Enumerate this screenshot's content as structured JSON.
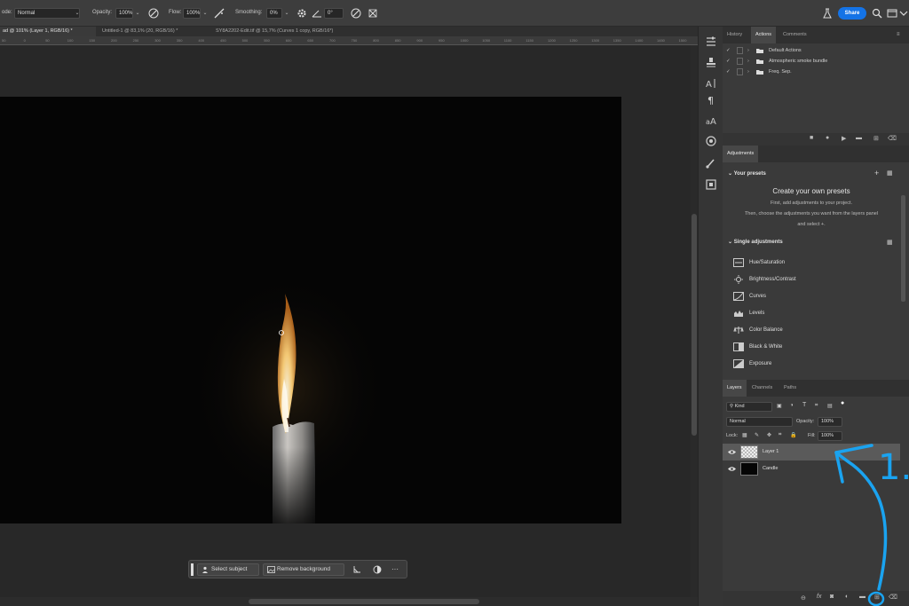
{
  "options_bar": {
    "mode_label": "ode:",
    "mode_value": "Normal",
    "opacity_label": "Opacity:",
    "opacity_value": "100%",
    "flow_label": "Flow:",
    "flow_value": "100%",
    "smoothing_label": "Smoothing:",
    "smoothing_value": "0%",
    "angle_value": "0°",
    "share_label": "Share"
  },
  "tabs": [
    {
      "label": "ad @ 101% (Layer 1, RGB/16) *",
      "active": true
    },
    {
      "label": "Untitled-1 @ 83,1% (20, RGB/16) *",
      "active": false
    },
    {
      "label": "SY8A2202-Edit.tif @ 15,7% (Curves 1 copy, RGB/16*)",
      "active": false
    }
  ],
  "ruler_ticks": [
    "50",
    "0",
    "50",
    "100",
    "150",
    "200",
    "250",
    "300",
    "350",
    "400",
    "450",
    "500",
    "550",
    "600",
    "650",
    "700",
    "750",
    "800",
    "850",
    "900",
    "950",
    "1000",
    "1050",
    "1100",
    "1150",
    "1200",
    "1250",
    "1300",
    "1350",
    "1400",
    "1450",
    "1500"
  ],
  "taskbar": {
    "select_subject": "Select subject",
    "remove_background": "Remove background",
    "more": "···"
  },
  "history_panel": {
    "tabs": [
      "History",
      "Actions",
      "Comments"
    ],
    "active_tab": "Actions",
    "actions": [
      "Default Actions",
      "Atmospheric smoke bundle",
      "Freq. Sep."
    ]
  },
  "adjustments_panel": {
    "title": "Adjustments",
    "your_presets": "Your presets",
    "create_title": "Create your own presets",
    "create_line1": "First, add adjustments to your project.",
    "create_line2": "Then, choose the adjustments you want from the layers panel",
    "create_line3": "and select",
    "single_adjustments": "Single adjustments",
    "items": [
      "Hue/Saturation",
      "Brightness/Contrast",
      "Curves",
      "Levels",
      "Color Balance",
      "Black & White",
      "Exposure"
    ]
  },
  "layers_panel": {
    "tabs": [
      "Layers",
      "Channels",
      "Paths"
    ],
    "active_tab": "Layers",
    "kind_label": "Kind",
    "blend_mode": "Normal",
    "opacity_label": "Opacity:",
    "opacity_value": "100%",
    "lock_label": "Lock:",
    "fill_label": "Fill:",
    "fill_value": "100%",
    "layers": [
      {
        "name": "Layer 1",
        "selected": true
      },
      {
        "name": "Candle",
        "selected": false
      }
    ],
    "footer_fx": "fx"
  },
  "annotation": {
    "label": "1.",
    "color": "#1aa3f0"
  },
  "colors": {
    "accent": "#1473e6",
    "annotation": "#1aa3f0"
  }
}
